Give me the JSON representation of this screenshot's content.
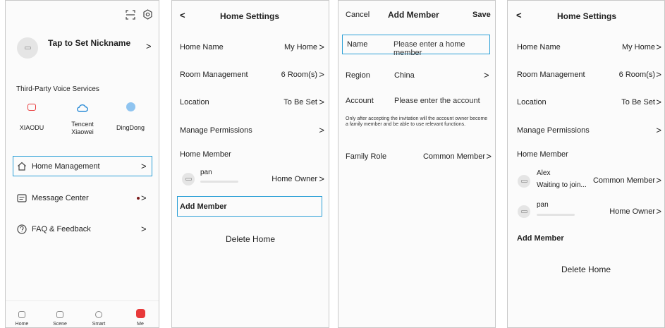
{
  "me": {
    "nickname": "Tap to Set Nickname",
    "voice_title": "Third-Party Voice Services",
    "voice": [
      {
        "label": "XIAODU"
      },
      {
        "label": "Tencent\nXiaowei"
      },
      {
        "label": "DingDong"
      }
    ],
    "menu": [
      {
        "label": "Home Management"
      },
      {
        "label": "Message Center"
      },
      {
        "label": "FAQ & Feedback"
      }
    ],
    "tabs": [
      "Home",
      "Scene",
      "Smart",
      "Me"
    ],
    "accent": "#e8393a",
    "highlight": "#2a9fd6"
  },
  "home_settings": {
    "title": "Home Settings",
    "rows": {
      "home_name": {
        "label": "Home Name",
        "value": "My Home"
      },
      "rooms": {
        "label": "Room Management",
        "value": "6 Room(s)"
      },
      "location": {
        "label": "Location",
        "value": "To Be Set"
      },
      "permissions": {
        "label": "Manage Permissions"
      }
    },
    "member_header": "Home Member",
    "member": {
      "name": "pan",
      "role": "Home Owner"
    },
    "add_member": "Add Member",
    "delete_home": "Delete Home"
  },
  "add_member": {
    "cancel": "Cancel",
    "title": "Add Member",
    "save": "Save",
    "name_label": "Name",
    "name_placeholder": "Please enter a home member",
    "region_label": "Region",
    "region_value": "China",
    "account_label": "Account",
    "account_placeholder": "Please enter the account",
    "note": "Only after accepting the invitation will the account owner become a family member and be able to use relevant functions.",
    "role_label": "Family Role",
    "role_value": "Common Member"
  },
  "home_settings_2": {
    "title": "Home Settings",
    "rows": {
      "home_name": {
        "label": "Home Name",
        "value": "My Home"
      },
      "rooms": {
        "label": "Room Management",
        "value": "6 Room(s)"
      },
      "location": {
        "label": "Location",
        "value": "To Be Set"
      },
      "permissions": {
        "label": "Manage Permissions"
      }
    },
    "member_header": "Home Member",
    "members": [
      {
        "name": "Alex",
        "status": "Waiting to join...",
        "role": "Common Member"
      },
      {
        "name": "pan",
        "role": "Home Owner"
      }
    ],
    "add_member": "Add Member",
    "delete_home": "Delete Home"
  },
  "glyphs": {
    "back": "<",
    "chevron": ">"
  }
}
